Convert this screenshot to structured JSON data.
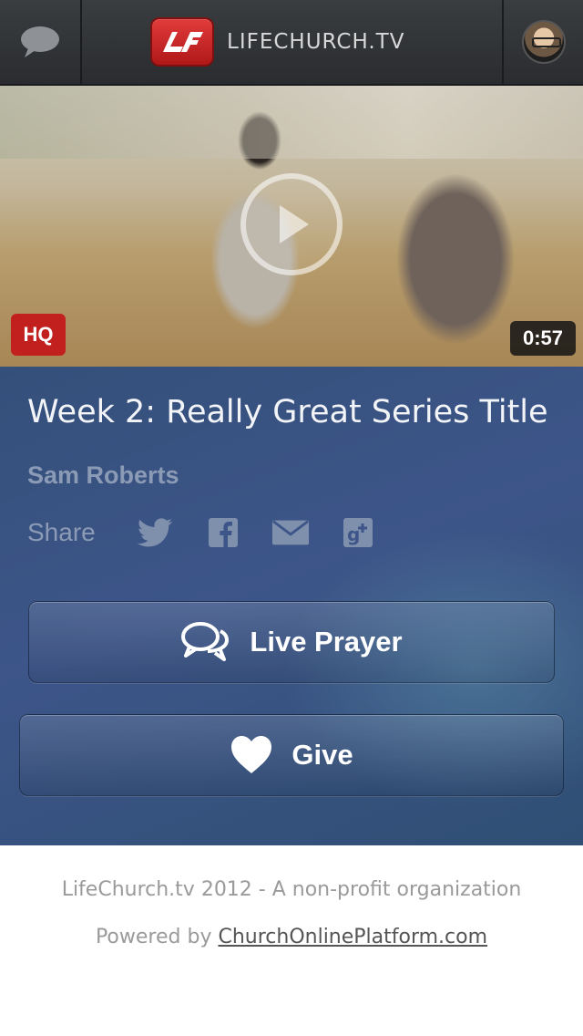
{
  "header": {
    "brand_name": "LIFECHURCH.TV",
    "left_icon": "chat-bubble-icon",
    "right_icon": "user-avatar"
  },
  "video": {
    "hq_label": "HQ",
    "duration": "0:57",
    "play_icon": "play-icon"
  },
  "message": {
    "title": "Week 2: Really Great Series Title",
    "speaker": "Sam Roberts",
    "share_label": "Share",
    "share_icons": [
      "twitter-icon",
      "facebook-icon",
      "email-icon",
      "google-plus-icon"
    ]
  },
  "actions": {
    "prayer_label": "Live Prayer",
    "give_label": "Give"
  },
  "footer": {
    "copyright": "LifeChurch.tv 2012 - A non-profit organization",
    "powered_prefix": "Powered by ",
    "powered_link": "ChurchOnlinePlatform.com"
  },
  "colors": {
    "header_bg": "#2f3134",
    "brand_red": "#c2201f",
    "panel_blue": "#3a5385",
    "button_text": "#ffffff",
    "muted_text": "#8c9bb5"
  }
}
